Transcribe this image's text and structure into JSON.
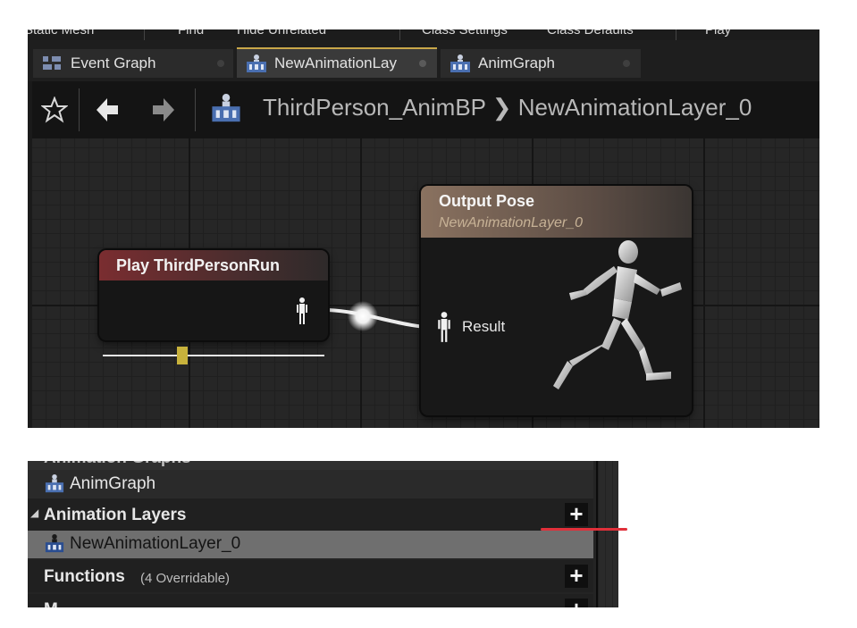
{
  "toolbar": {
    "items": [
      "Static Mesh",
      "Find",
      "Hide Unrelated",
      "Class Settings",
      "Class Defaults",
      "Play"
    ]
  },
  "tabs": [
    {
      "label": "Event Graph",
      "icon": "event-graph-icon",
      "active": false
    },
    {
      "label": "NewAnimationLay",
      "icon": "anim-layer-icon",
      "active": true
    },
    {
      "label": "AnimGraph",
      "icon": "anim-graph-icon",
      "active": false
    }
  ],
  "breadcrumb": {
    "text": "ThirdPerson_AnimBP ❯ NewAnimationLayer_0"
  },
  "nodes": {
    "play": {
      "title": "Play ThirdPersonRun"
    },
    "output": {
      "title": "Output Pose",
      "subtitle": "NewAnimationLayer_0",
      "pin_label": "Result"
    }
  },
  "slider": {
    "value_fraction": 0.36
  },
  "panel": {
    "truncated_header": "Animation Graphs",
    "graph_item": "AnimGraph",
    "layers_header": "Animation Layers",
    "layer_item": "NewAnimationLayer_0",
    "functions_header": "Functions",
    "functions_note": "(4 Overridable)",
    "next_header_cut": "M",
    "plus_symbol": "+"
  },
  "colors": {
    "tab_accent": "#c9a84a",
    "play_node_header": "#7a2d30",
    "output_node_header": "#8a7260",
    "output_subtitle": "#c7b296",
    "slider_thumb": "#c8b23c",
    "annotation_underline": "#e0303a",
    "selected_row": "#6f6f6f"
  }
}
